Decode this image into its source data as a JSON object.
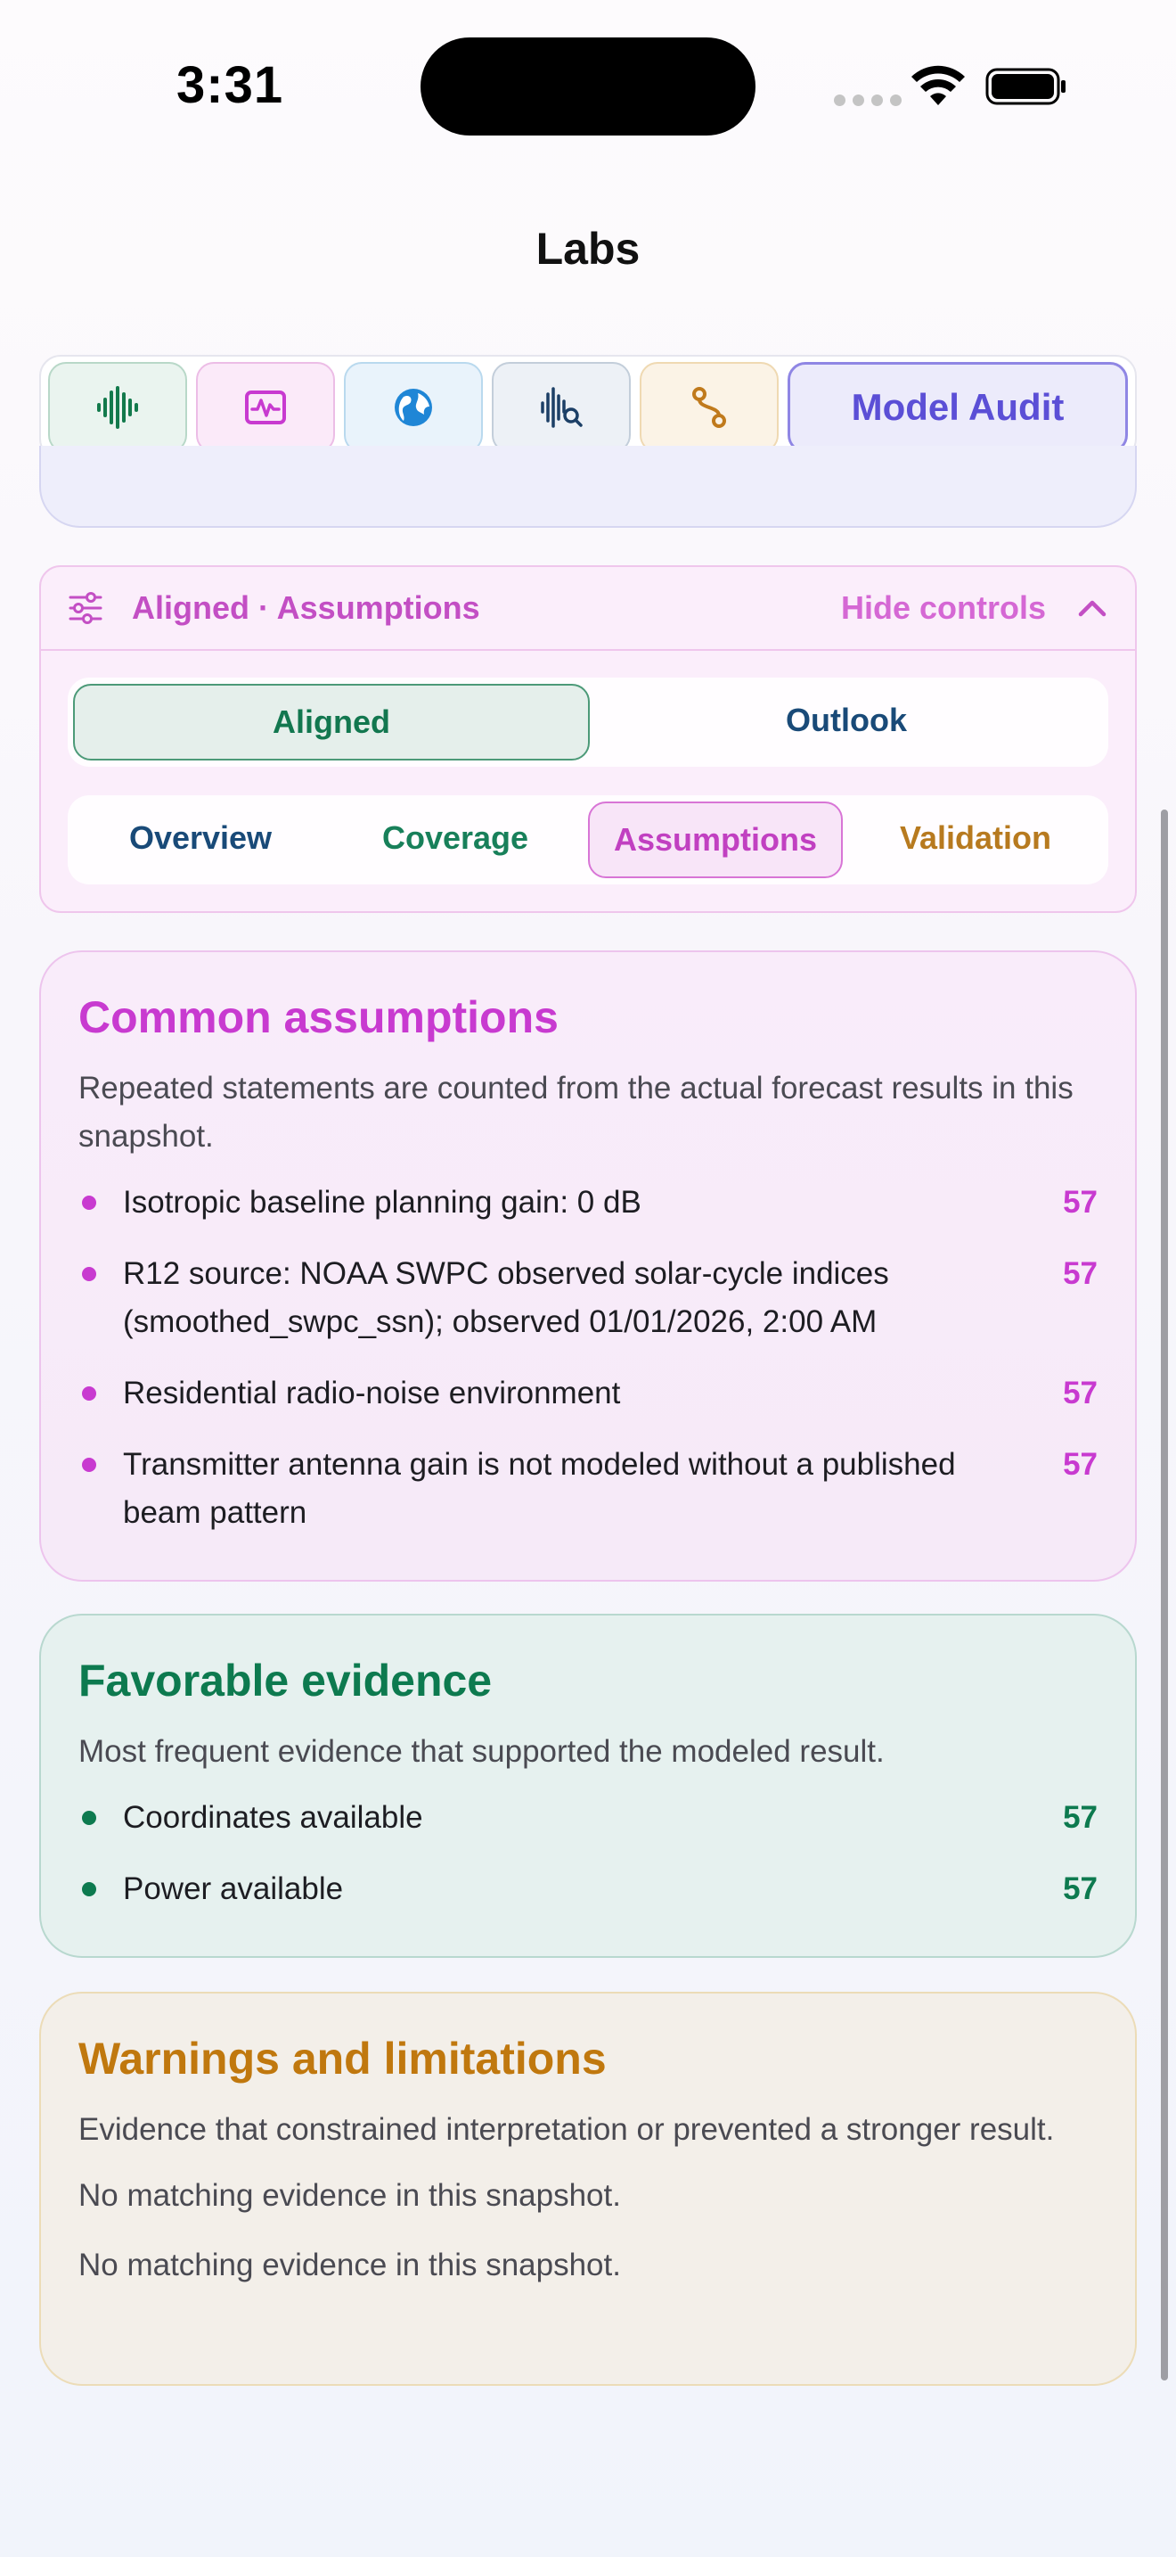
{
  "status_bar": {
    "time": "3:31"
  },
  "nav": {
    "title": "Labs"
  },
  "tabs": [
    {
      "icon": "waveform-icon",
      "color": "#137a4c"
    },
    {
      "icon": "waveform-monitor-icon",
      "color": "#c83ad0"
    },
    {
      "icon": "globe-icon",
      "color": "#1f86d6"
    },
    {
      "icon": "waveform-search-icon",
      "color": "#1c3f66"
    },
    {
      "icon": "route-icon",
      "color": "#c07a1c"
    },
    {
      "label": "Model Audit",
      "color": "#5b4fd6"
    }
  ],
  "controls": {
    "title": "Aligned · Assumptions",
    "hide_label": "Hide controls",
    "mode": {
      "options": [
        "Aligned",
        "Outlook"
      ],
      "selected": "Aligned"
    },
    "sections": {
      "options": [
        "Overview",
        "Coverage",
        "Assumptions",
        "Validation"
      ],
      "selected": "Assumptions"
    }
  },
  "assumptions": {
    "title": "Common assumptions",
    "description": "Repeated statements are counted from the actual forecast results in this snapshot.",
    "items": [
      {
        "text": "Isotropic baseline planning gain: 0 dB",
        "count": "57"
      },
      {
        "text": "R12 source: NOAA SWPC observed solar-cycle indices (smoothed_swpc_ssn); observed 01/01/2026, 2:00 AM",
        "count": "57"
      },
      {
        "text": "Residential radio-noise environment",
        "count": "57"
      },
      {
        "text": "Transmitter antenna gain is not modeled without a published beam pattern",
        "count": "57"
      }
    ]
  },
  "favorable": {
    "title": "Favorable evidence",
    "description": "Most frequent evidence that supported the modeled result.",
    "items": [
      {
        "text": "Coordinates available",
        "count": "57"
      },
      {
        "text": "Power available",
        "count": "57"
      }
    ]
  },
  "warnings": {
    "title": "Warnings and limitations",
    "description": "Evidence that constrained interpretation or prevented a stronger result.",
    "empty_1": "No matching evidence in this snapshot.",
    "empty_2": "No matching evidence in this snapshot."
  }
}
